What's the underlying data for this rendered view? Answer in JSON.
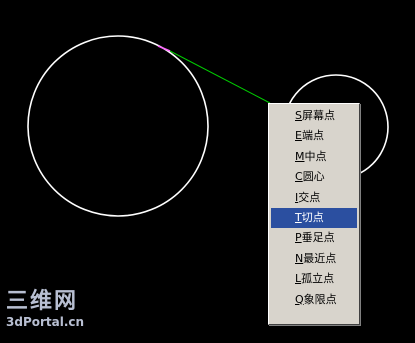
{
  "canvas": {
    "background_color": "#000000",
    "circle_color": "#ffffff",
    "tangent_line_color": "#00cc00",
    "snap_marker_color": "#ff66ff"
  },
  "osnap_menu": {
    "items": [
      {
        "accel": "S",
        "label": "屏幕点",
        "selected": false
      },
      {
        "accel": "E",
        "label": "端点",
        "selected": false
      },
      {
        "accel": "M",
        "label": "中点",
        "selected": false
      },
      {
        "accel": "C",
        "label": "圆心",
        "selected": false
      },
      {
        "accel": "I",
        "label": "交点",
        "selected": false
      },
      {
        "accel": "T",
        "label": "切点",
        "selected": true
      },
      {
        "accel": "P",
        "label": "垂足点",
        "selected": false
      },
      {
        "accel": "N",
        "label": "最近点",
        "selected": false
      },
      {
        "accel": "L",
        "label": "孤立点",
        "selected": false
      },
      {
        "accel": "Q",
        "label": "象限点",
        "selected": false
      }
    ],
    "selected_color": "#2b4fa0"
  },
  "watermark": {
    "logo": "三维网",
    "site": "3dPortal.cn"
  }
}
